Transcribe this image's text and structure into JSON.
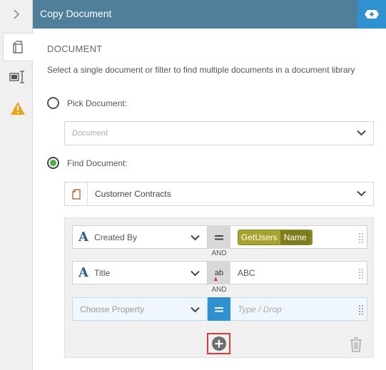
{
  "header": {
    "title": "Copy Document"
  },
  "sidebar": {
    "tabs": [
      {
        "icon": "document-icon",
        "active": true
      },
      {
        "icon": "form-field-icon",
        "active": false
      },
      {
        "icon": "warning-icon",
        "active": false
      }
    ]
  },
  "section": {
    "title": "DOCUMENT",
    "description": "Select a single document or filter to find multiple documents in a document library"
  },
  "pick": {
    "label": "Pick Document:",
    "checked": false,
    "placeholder": "Document"
  },
  "find": {
    "label": "Find Document:",
    "checked": true,
    "library": "Customer Contracts"
  },
  "conditions": [
    {
      "property": "Created By",
      "operator": "=",
      "value_tokens": [
        "GetUsers",
        "Name"
      ]
    },
    {
      "property": "Title",
      "operator": "ab",
      "value": "ABC"
    },
    {
      "property_placeholder": "Choose Property",
      "operator": "=",
      "value_placeholder": "Type / Drop"
    }
  ],
  "and_labels": [
    "AND",
    "AND"
  ],
  "colors": {
    "header": "#4f7f9a",
    "accent": "#2f91d0",
    "token": "#a6a42e",
    "token_dark": "#7e7d1e",
    "success": "#4cae4c",
    "warning": "#e8a317",
    "highlight": "#e53935"
  }
}
